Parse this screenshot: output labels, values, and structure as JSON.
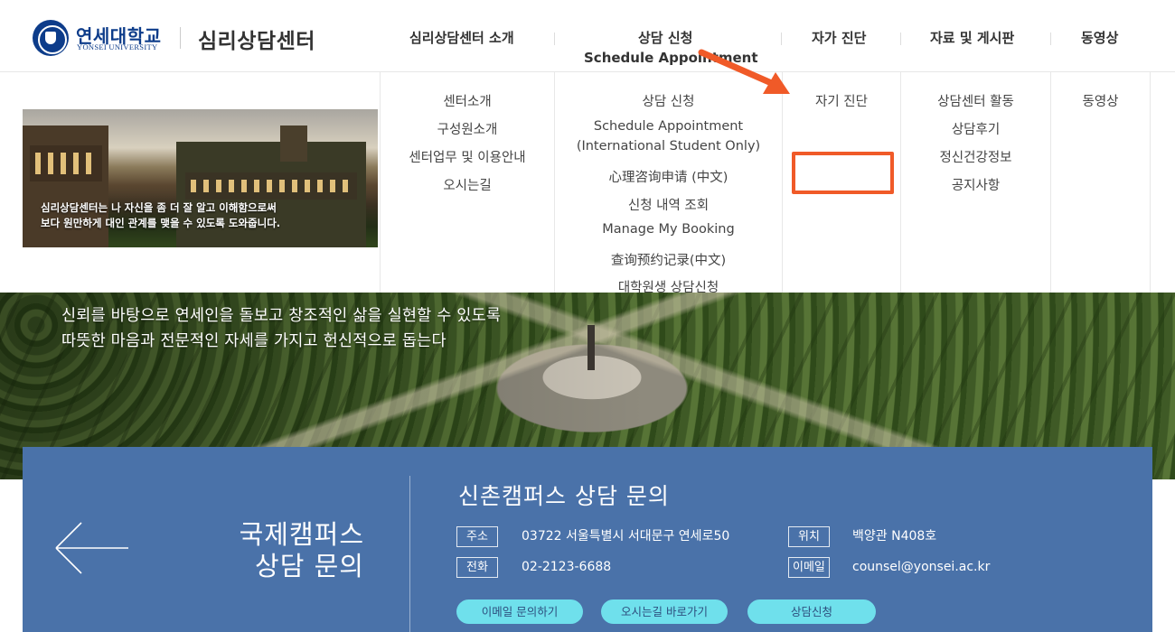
{
  "header": {
    "logo_ko": "연세대학교",
    "logo_en": "YONSEI UNIVERSITY",
    "site_title": "심리상담센터",
    "nav": [
      {
        "label": "심리상담센터 소개"
      },
      {
        "label": "상담 신청",
        "sub": "Schedule Appointment"
      },
      {
        "label": "자가 진단"
      },
      {
        "label": "자료 및 게시판"
      },
      {
        "label": "동영상"
      }
    ]
  },
  "mega_menu": {
    "banner_text": [
      "심리상담센터는 나 자신을 좀 더 잘 알고 이해함으로써",
      "보다 원만하게 대인 관계를 맺을 수 있도록 도와줍니다."
    ],
    "col_about": [
      "센터소개",
      "구성원소개",
      "센터업무 및 이용안내",
      "오시는길"
    ],
    "col_apply": [
      "상담 신청",
      "Schedule Appointment",
      "(International Student Only)",
      "心理咨询申请 (中文)",
      "신청 내역 조회",
      "Manage My Booking",
      "查询预约记录(中文)",
      "대학원생 상담신청"
    ],
    "col_self": [
      "자기 진단"
    ],
    "col_board": [
      "상담센터 활동",
      "상담후기",
      "정신건강정보",
      "공지사항"
    ],
    "col_video": [
      "동영상"
    ]
  },
  "hero": {
    "lines": [
      "신뢰를 바탕으로 연세인을 돌보고 창조적인 삶을 실현할 수 있도록",
      "따뜻한 마음과 전문적인 자세를 가지고 헌신적으로 돕는다"
    ]
  },
  "contact": {
    "intl_title_1": "국제캠퍼스",
    "intl_title_2": "상담 문의",
    "sinchon_title": "신촌캠퍼스 상담 문의",
    "address_label": "주소",
    "address": "03722 서울특별시 서대문구 연세로50",
    "phone_label": "전화",
    "phone": "02-2123-6688",
    "location_label": "위치",
    "location": "백양관 N408호",
    "email_label": "이메일",
    "email": "counsel@yonsei.ac.kr",
    "btn_email": "이메일 문의하기",
    "btn_directions": "오시는길 바로가기",
    "btn_apply": "상담신청"
  },
  "colors": {
    "brand_blue": "#0d3c8a",
    "panel_blue": "#4a72a9",
    "pill_cyan": "#6fe0ec",
    "highlight_orange": "#f05a28"
  }
}
